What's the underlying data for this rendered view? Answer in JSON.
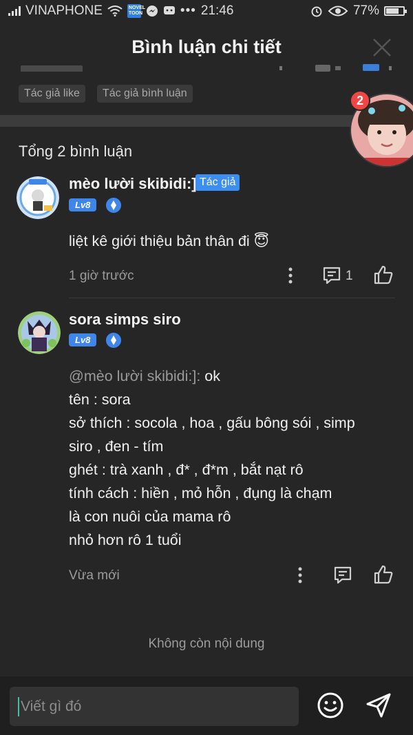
{
  "status_bar": {
    "carrier": "VINAPHONE",
    "time": "21:46",
    "battery": "77%",
    "battery_level": 0.77,
    "app_badge_text": "NOVEL\nTOON",
    "icons": [
      "signal-icon",
      "wifi-icon",
      "novel-toon-icon",
      "messenger-icon",
      "chat-icon",
      "more-icon",
      "alarm-icon",
      "eye-icon",
      "battery-icon"
    ]
  },
  "header": {
    "title": "Bình luận chi tiết",
    "close_icon": "close-icon"
  },
  "parent_comment": {
    "tags": [
      "Tác giả like",
      "Tác giả bình luận"
    ]
  },
  "floating_chat": {
    "badge_count": "2"
  },
  "summary": {
    "total": "Tổng 2 bình luận"
  },
  "comments": [
    {
      "name": "mèo lười skibidi:]",
      "badge": "Tác giả",
      "level": "Lv8",
      "text": "liệt kê giới thiệu bản thân đi 😇",
      "time": "1 giờ trước",
      "reply_count": "1"
    },
    {
      "name": "sora simps siro",
      "level": "Lv8",
      "mention": "@mèo lười skibidi:]:",
      "lines": [
        " ok",
        "tên : sora",
        "sở thích : socola , hoa , gấu bông sói , simp",
        "siro , đen - tím",
        "ghét : trà xanh , đ* , đ*m , bắt nạt rô",
        "tính cách : hiền , mỏ hỗn , đụng là chạm",
        "là con nuôi của mama rô",
        "nhỏ hơn rô 1 tuổi"
      ],
      "time": "Vừa mới"
    }
  ],
  "end_note": "Không còn nội dung",
  "composer": {
    "placeholder": "Viết gì đó"
  },
  "colors": {
    "background": "#262626",
    "accent": "#3c8ff0",
    "badge_red": "#f04646"
  }
}
